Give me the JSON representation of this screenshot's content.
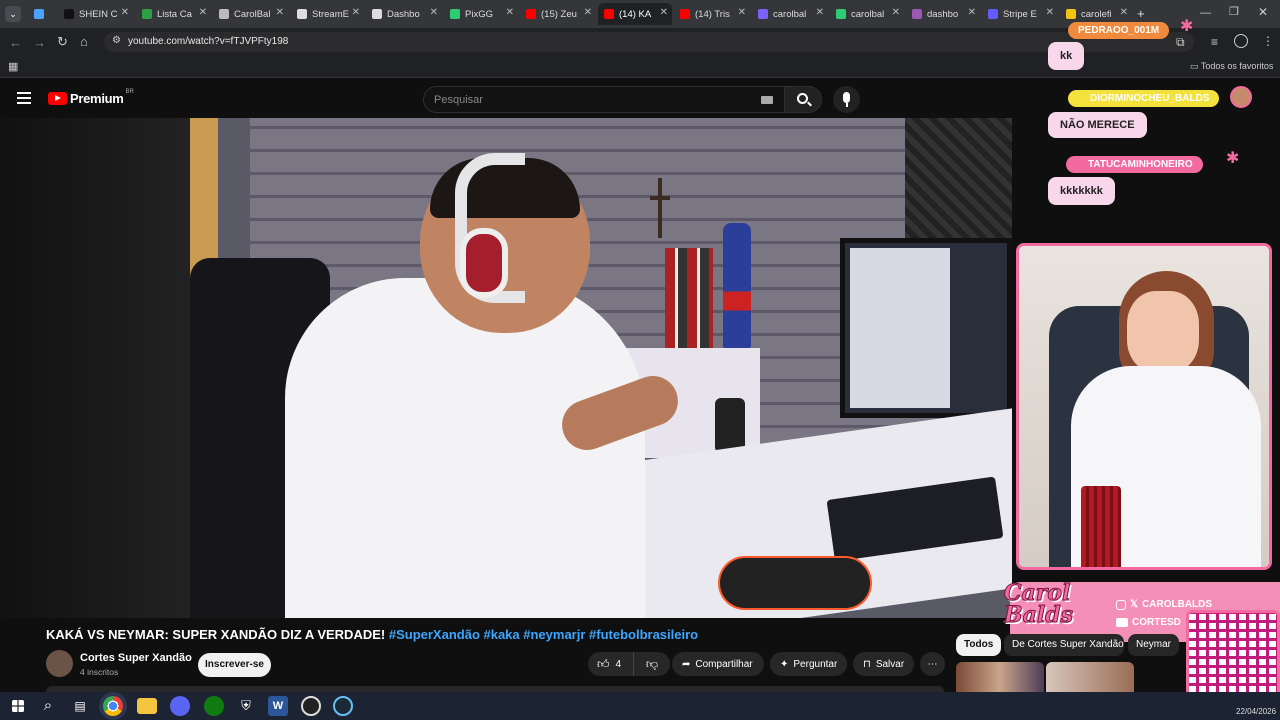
{
  "browser": {
    "tabs": [
      {
        "label": "",
        "color": "#4aa3ff"
      },
      {
        "label": "SHEIN C",
        "color": "#111111"
      },
      {
        "label": "Lista Ca",
        "color": "#2ea043"
      },
      {
        "label": "CarolBal",
        "color": "#bbbbbb"
      },
      {
        "label": "StreamE",
        "color": "#dddddd"
      },
      {
        "label": "Dashbo",
        "color": "#dddddd"
      },
      {
        "label": "PixGG",
        "color": "#2ecc71"
      },
      {
        "label": "(15) Zeu",
        "color": "#ff0000"
      },
      {
        "label": "(14) KA",
        "color": "#ff0000"
      },
      {
        "label": "(14) Tris",
        "color": "#ff0000"
      },
      {
        "label": "carolbal",
        "color": "#7b61ff"
      },
      {
        "label": "carolbal",
        "color": "#2ecc71"
      },
      {
        "label": "dashbo",
        "color": "#9b59b6"
      },
      {
        "label": "Stripe E",
        "color": "#635bff"
      },
      {
        "label": "carolefi",
        "color": "#f1c40f"
      }
    ],
    "url": "youtube.com/watch?v=fTJVPFty198",
    "bookmarks_label": "Todos os favoritos"
  },
  "youtube": {
    "logo_text": "Premium",
    "region": "BR",
    "search_placeholder": "Pesquisar",
    "video_title": "KAKÁ VS NEYMAR: SUPER XANDÃO DIZ A VERDADE!",
    "video_tags": "#SuperXandão #kaka #neymarjr #futebolbrasileiro",
    "channel_name": "Cortes Super Xandão",
    "subscribers": "4 inscritos",
    "subscribe_label": "Inscrever-se",
    "likes": "4",
    "share_label": "Compartilhar",
    "ask_label": "Perguntar",
    "save_label": "Salvar",
    "chips": [
      "Todos",
      "De Cortes Super Xandão",
      "Neymar"
    ]
  },
  "overlay": {
    "chat": [
      {
        "user": "PEDRAOO_001M",
        "message": "kk"
      },
      {
        "user": "DIORMINOCHEU_BALDS",
        "message": "NÃO MERECE"
      },
      {
        "user": "TATUCAMINHONEIRO",
        "message": "kkkkkkk"
      }
    ],
    "brand": "Carol Balds",
    "socials": [
      "CAROLBALDS",
      "CORTESD"
    ]
  },
  "taskbar": {
    "date": "22/04/2026"
  },
  "colors": {
    "youtube_red": "#ff0000",
    "overlay_pink": "#f26aa0",
    "link_blue": "#3ea6ff"
  }
}
